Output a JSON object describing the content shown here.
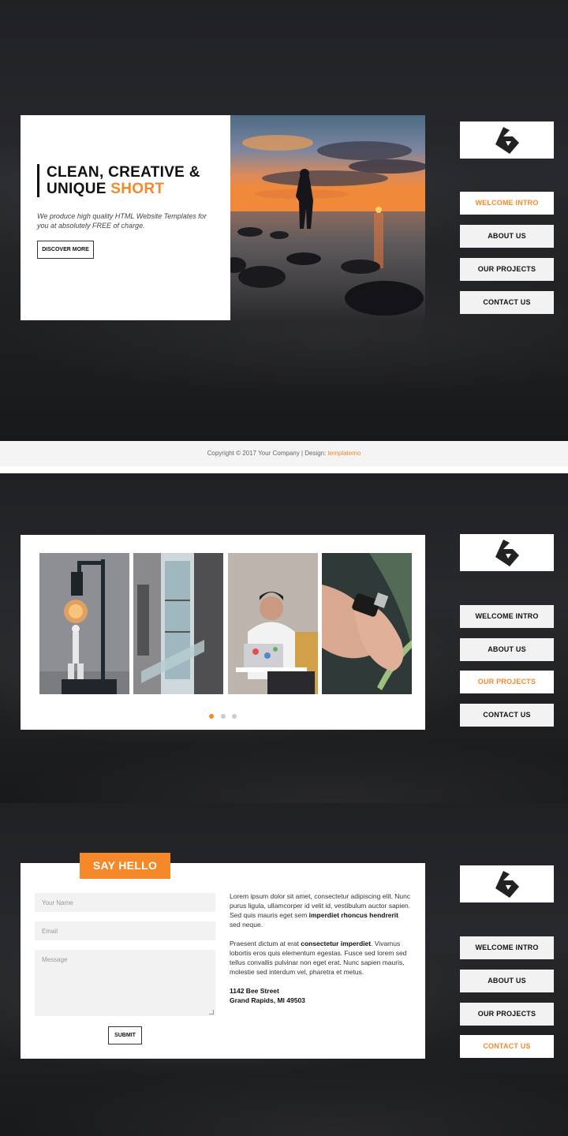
{
  "nav": {
    "items": [
      "WELCOME INTRO",
      "ABOUT US",
      "OUR PROJECTS",
      "CONTACT US"
    ]
  },
  "intro": {
    "title_line1": "CLEAN, CREATIVE &",
    "title_line2": "UNIQUE",
    "title_accent": "SHORT",
    "subtitle": "We produce high quality HTML Website Templates for you at absolutely FREE of charge.",
    "button": "DISCOVER MORE",
    "image_alt": "person standing on rocks at sunset by the sea"
  },
  "footer": {
    "copyright": "Copyright © 2017 Your Company | Design: ",
    "link": "templatemo"
  },
  "projects": {
    "thumbs": [
      "lamp-figure",
      "glass-building",
      "man-with-laptop",
      "smartwatch-hand"
    ],
    "dots": 3,
    "active_dot": 1
  },
  "contact": {
    "heading": "SAY HELLO",
    "name_placeholder": "Your Name",
    "email_placeholder": "Email",
    "message_placeholder": "Message",
    "submit": "SUBMIT",
    "para1_a": "Lorem ipsum dolor sit amet, consectetur adipiscing elit. Nunc purus ligula, ullamcorper id velit id, vestibulum auctor sapien. Sed quis mauris eget sem ",
    "para1_b": "imperdiet rhoncus hendrerit",
    "para1_c": " sed neque.",
    "para2_a": "Praesent dictum at erat ",
    "para2_b": "consectetur imperdiet",
    "para2_c": ". Vivamus lobortis eros quis elementum egestas. Fusce sed lorem sed tellus convallis pulvinar non eget erat. Nunc sapien mauris, molestie sed interdum vel, pharetra et metus.",
    "address_line1": "1142 Bee Street",
    "address_line2": "Grand Rapids, MI 49503"
  },
  "colors": {
    "accent": "#f5892a",
    "dark_bg": "#1e1f21",
    "card": "#ffffff"
  }
}
